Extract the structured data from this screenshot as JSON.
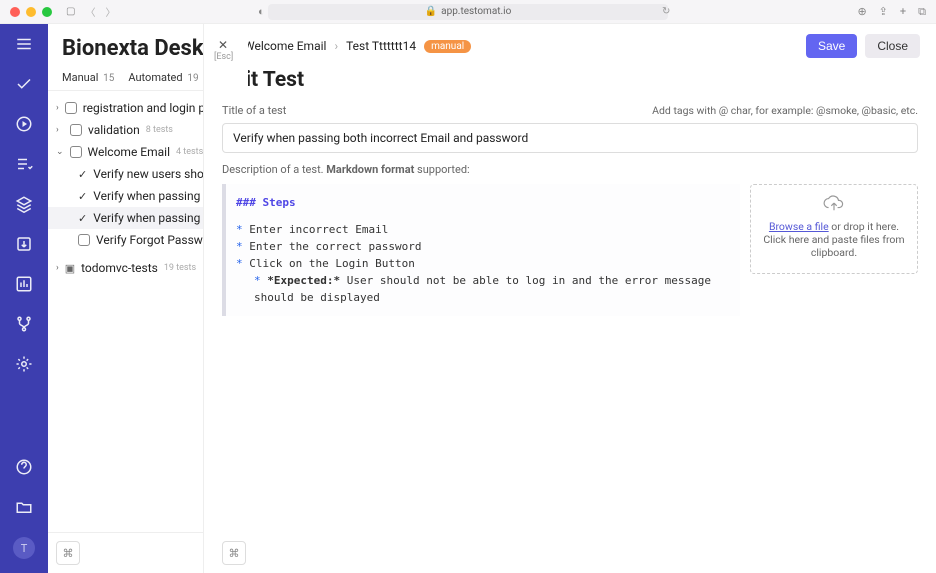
{
  "browser": {
    "address": "app.testomat.io"
  },
  "rail_avatar_letter": "T",
  "project_title": "Bionexta Deskto",
  "close_hint": "[Esc]",
  "tabs": {
    "manual": {
      "label": "Manual",
      "count": "15"
    },
    "automated": {
      "label": "Automated",
      "count": "19"
    }
  },
  "tree": {
    "registration": {
      "label": "registration and login pa"
    },
    "validation": {
      "label": "validation",
      "count": "8 tests"
    },
    "welcome": {
      "label": "Welcome Email",
      "count": "4 tests",
      "children": {
        "new_users": {
          "label": "Verify new users sho"
        },
        "passing1": {
          "label": "Verify when passing"
        },
        "passing2": {
          "label": "Verify when passing"
        },
        "forgot": {
          "label": "Verify Forgot Passwor"
        }
      }
    },
    "todomvc": {
      "label": "todomvc-tests",
      "count": "19 tests"
    }
  },
  "breadcrumb": {
    "suite": "Welcome Email",
    "test": "Test Ttttttt14",
    "badge": "manual"
  },
  "buttons": {
    "save": "Save",
    "close": "Close"
  },
  "page_heading": "Edit Test",
  "title_field": {
    "label": "Title of a test",
    "hint": "Add tags with @ char, for example: @smoke, @basic, etc.",
    "value": "Verify when passing both incorrect Email and password"
  },
  "desc_field": {
    "label_prefix": "Description of a test. ",
    "label_bold": "Markdown format",
    "label_suffix": " supported:"
  },
  "editor": {
    "steps_header": "### Steps",
    "step1": "Enter incorrect Email",
    "step2": "Enter the correct password",
    "step3": "Click on the Login Button",
    "expected_label": "*Expected:*",
    "expected_text": " User should not be able to log in and the error message should be displayed"
  },
  "attach_box": {
    "browse": "Browse a file",
    "rest": " or drop it here. Click here and paste files from clipboard."
  }
}
